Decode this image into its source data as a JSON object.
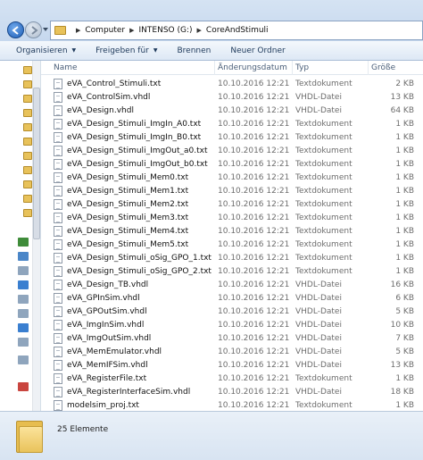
{
  "address": {
    "crumbs": [
      "Computer",
      "INTENSO (G:)",
      "CoreAndStimuli"
    ]
  },
  "toolbar": {
    "organize_label": "Organisieren",
    "share_label": "Freigeben für",
    "burn_label": "Brennen",
    "new_folder_label": "Neuer Ordner"
  },
  "columns": {
    "name": "Name",
    "date": "Änderungsdatum",
    "type": "Typ",
    "size": "Größe"
  },
  "files": [
    {
      "name": "eVA_Control_Stimuli.txt",
      "date": "10.10.2016 12:21",
      "type": "Textdokument",
      "size": "2 KB"
    },
    {
      "name": "eVA_ControlSim.vhdl",
      "date": "10.10.2016 12:21",
      "type": "VHDL-Datei",
      "size": "13 KB"
    },
    {
      "name": "eVA_Design.vhdl",
      "date": "10.10.2016 12:21",
      "type": "VHDL-Datei",
      "size": "64 KB"
    },
    {
      "name": "eVA_Design_Stimuli_ImgIn_A0.txt",
      "date": "10.10.2016 12:21",
      "type": "Textdokument",
      "size": "1 KB"
    },
    {
      "name": "eVA_Design_Stimuli_ImgIn_B0.txt",
      "date": "10.10.2016 12:21",
      "type": "Textdokument",
      "size": "1 KB"
    },
    {
      "name": "eVA_Design_Stimuli_ImgOut_a0.txt",
      "date": "10.10.2016 12:21",
      "type": "Textdokument",
      "size": "1 KB"
    },
    {
      "name": "eVA_Design_Stimuli_ImgOut_b0.txt",
      "date": "10.10.2016 12:21",
      "type": "Textdokument",
      "size": "1 KB"
    },
    {
      "name": "eVA_Design_Stimuli_Mem0.txt",
      "date": "10.10.2016 12:21",
      "type": "Textdokument",
      "size": "1 KB"
    },
    {
      "name": "eVA_Design_Stimuli_Mem1.txt",
      "date": "10.10.2016 12:21",
      "type": "Textdokument",
      "size": "1 KB"
    },
    {
      "name": "eVA_Design_Stimuli_Mem2.txt",
      "date": "10.10.2016 12:21",
      "type": "Textdokument",
      "size": "1 KB"
    },
    {
      "name": "eVA_Design_Stimuli_Mem3.txt",
      "date": "10.10.2016 12:21",
      "type": "Textdokument",
      "size": "1 KB"
    },
    {
      "name": "eVA_Design_Stimuli_Mem4.txt",
      "date": "10.10.2016 12:21",
      "type": "Textdokument",
      "size": "1 KB"
    },
    {
      "name": "eVA_Design_Stimuli_Mem5.txt",
      "date": "10.10.2016 12:21",
      "type": "Textdokument",
      "size": "1 KB"
    },
    {
      "name": "eVA_Design_Stimuli_oSig_GPO_1.txt",
      "date": "10.10.2016 12:21",
      "type": "Textdokument",
      "size": "1 KB"
    },
    {
      "name": "eVA_Design_Stimuli_oSig_GPO_2.txt",
      "date": "10.10.2016 12:21",
      "type": "Textdokument",
      "size": "1 KB"
    },
    {
      "name": "eVA_Design_TB.vhdl",
      "date": "10.10.2016 12:21",
      "type": "VHDL-Datei",
      "size": "16 KB"
    },
    {
      "name": "eVA_GPInSim.vhdl",
      "date": "10.10.2016 12:21",
      "type": "VHDL-Datei",
      "size": "6 KB"
    },
    {
      "name": "eVA_GPOutSim.vhdl",
      "date": "10.10.2016 12:21",
      "type": "VHDL-Datei",
      "size": "5 KB"
    },
    {
      "name": "eVA_ImgInSim.vhdl",
      "date": "10.10.2016 12:21",
      "type": "VHDL-Datei",
      "size": "10 KB"
    },
    {
      "name": "eVA_ImgOutSim.vhdl",
      "date": "10.10.2016 12:21",
      "type": "VHDL-Datei",
      "size": "7 KB"
    },
    {
      "name": "eVA_MemEmulator.vhdl",
      "date": "10.10.2016 12:21",
      "type": "VHDL-Datei",
      "size": "5 KB"
    },
    {
      "name": "eVA_MemIFSim.vhdl",
      "date": "10.10.2016 12:21",
      "type": "VHDL-Datei",
      "size": "13 KB"
    },
    {
      "name": "eVA_RegisterFile.txt",
      "date": "10.10.2016 12:21",
      "type": "Textdokument",
      "size": "1 KB"
    },
    {
      "name": "eVA_RegisterInterfaceSim.vhdl",
      "date": "10.10.2016 12:21",
      "type": "VHDL-Datei",
      "size": "18 KB"
    },
    {
      "name": "modelsim_proj.txt",
      "date": "10.10.2016 12:21",
      "type": "Textdokument",
      "size": "1 KB"
    }
  ],
  "status": {
    "item_count": "25 Elemente"
  },
  "colors": {
    "accent": "#1f5fb8",
    "folder": "#e8c25a",
    "toolbar_text": "#1e395b"
  }
}
